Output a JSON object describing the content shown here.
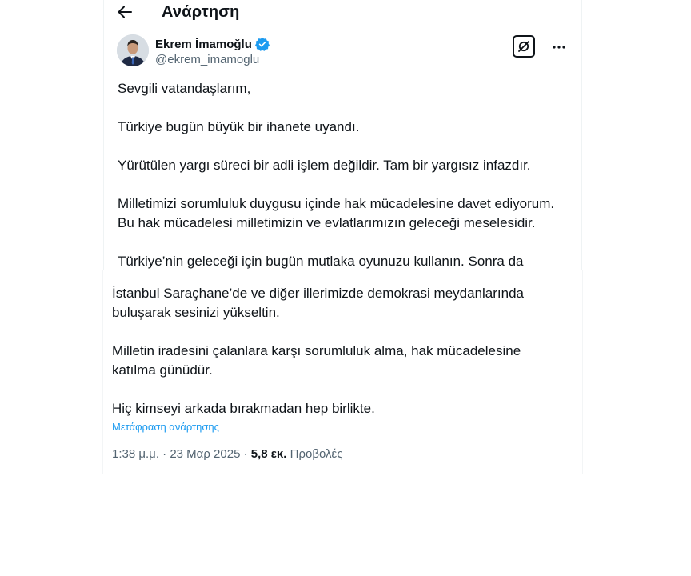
{
  "header": {
    "title": "Ανάρτηση",
    "back_icon": "arrow-left-icon"
  },
  "author": {
    "name": "Ekrem İmamoğlu",
    "handle": "@ekrem_imamoglu",
    "verified_icon": "verified-badge-icon",
    "verified_color": "#1d9bf0",
    "grok_icon": "grok-icon",
    "more_icon": "more-dots-icon"
  },
  "tweet": {
    "paragraphs_top": [
      "Sevgili vatandaşlarım,",
      "Türkiye bugün büyük bir ihanete uyandı.",
      "Yürütülen yargı süreci bir adli işlem değildir. Tam bir yargısız infazdır.",
      "Milletimizi sorumluluk duygusu içinde hak mücadelesine davet ediyorum.",
      "Bu hak mücadelesi milletimizin ve evlatlarımızın geleceği meselesidir.",
      "Türkiye’nin geleceği için bugün mutlaka oyunuzu kullanın. Sonra da"
    ],
    "paragraphs_bottom": [
      "İstanbul Saraçhane’de ve diğer illerimizde demokrasi meydanlarında",
      "buluşarak sesinizi yükseltin.",
      "Milletin iradesini çalanlara karşı sorumluluk alma, hak mücadelesine",
      "katılma günüdür.",
      "Hiç kimseyi arkada bırakmadan hep birlikte."
    ],
    "translate_label": "Μετάφραση ανάρτησης",
    "time": "1:38 μ.μ.",
    "separator": "·",
    "date": "23 Μαρ 2025",
    "views_count": "5,8 εκ.",
    "views_label": "Προβολές"
  },
  "colors": {
    "text": "#0f1419",
    "secondary": "#536471",
    "link": "#1d9bf0"
  }
}
